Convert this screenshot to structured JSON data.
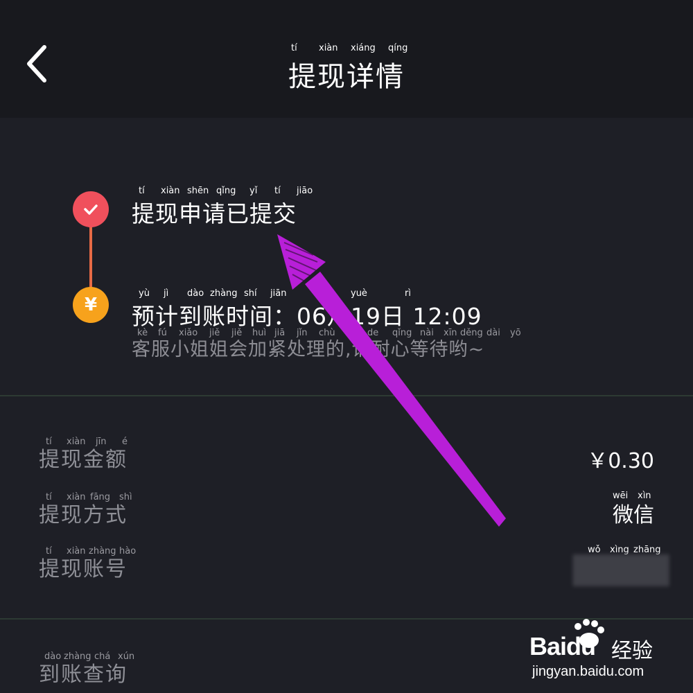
{
  "header": {
    "title": "提现详情",
    "title_pinyin": [
      "tí",
      "xiàn",
      "xiáng",
      "qíng"
    ]
  },
  "timeline": {
    "step1": {
      "title": "提现申请已提交",
      "pinyin": [
        "tí",
        "xiàn",
        "shēn",
        "qǐng",
        "yǐ",
        "tí",
        "jiāo"
      ],
      "icon": "check-icon",
      "color": "#f0505c"
    },
    "step2": {
      "title": "预计到账时间：06月19日 12:09",
      "pinyin": [
        "yù",
        "jì",
        "dào",
        "zhàng",
        "shí",
        "jiān",
        "yuè",
        "rì"
      ],
      "subtitle": "客服小姐姐会加紧处理的,请耐心等待哟~",
      "subtitle_pinyin": [
        "kè",
        "fú",
        "xiǎo",
        "jiě",
        "jiě",
        "huì",
        "jiā",
        "jǐn",
        "chù",
        "lǐ",
        "de",
        "qǐng",
        "nài",
        "xīn",
        "děng",
        "dài",
        "yō"
      ],
      "icon": "yen-icon",
      "icon_glyph": "¥",
      "color": "#f7a21c"
    }
  },
  "details": {
    "amount": {
      "label": "提现金额",
      "pinyin": [
        "tí",
        "xiàn",
        "jīn",
        "é"
      ],
      "value": "￥0.30"
    },
    "method": {
      "label": "提现方式",
      "pinyin": [
        "tí",
        "xiàn",
        "fāng",
        "shì"
      ],
      "value": "微信",
      "value_pinyin": [
        "wēi",
        "xìn"
      ]
    },
    "account": {
      "label": "提现账号",
      "pinyin": [
        "tí",
        "xiàn",
        "zhàng",
        "hào"
      ],
      "value_pinyin": [
        "wǒ",
        "xìng",
        "zhāng"
      ]
    }
  },
  "query": {
    "label": "到账查询",
    "pinyin": [
      "dào",
      "zhàng",
      "chá",
      "xún"
    ]
  },
  "watermark": {
    "brand": "Baidu",
    "cn": "经验",
    "url": "jingyan.baidu.com"
  },
  "colors": {
    "background": "#1e1f26",
    "header": "#18191e",
    "annotation_arrow": "#b81fd8"
  }
}
